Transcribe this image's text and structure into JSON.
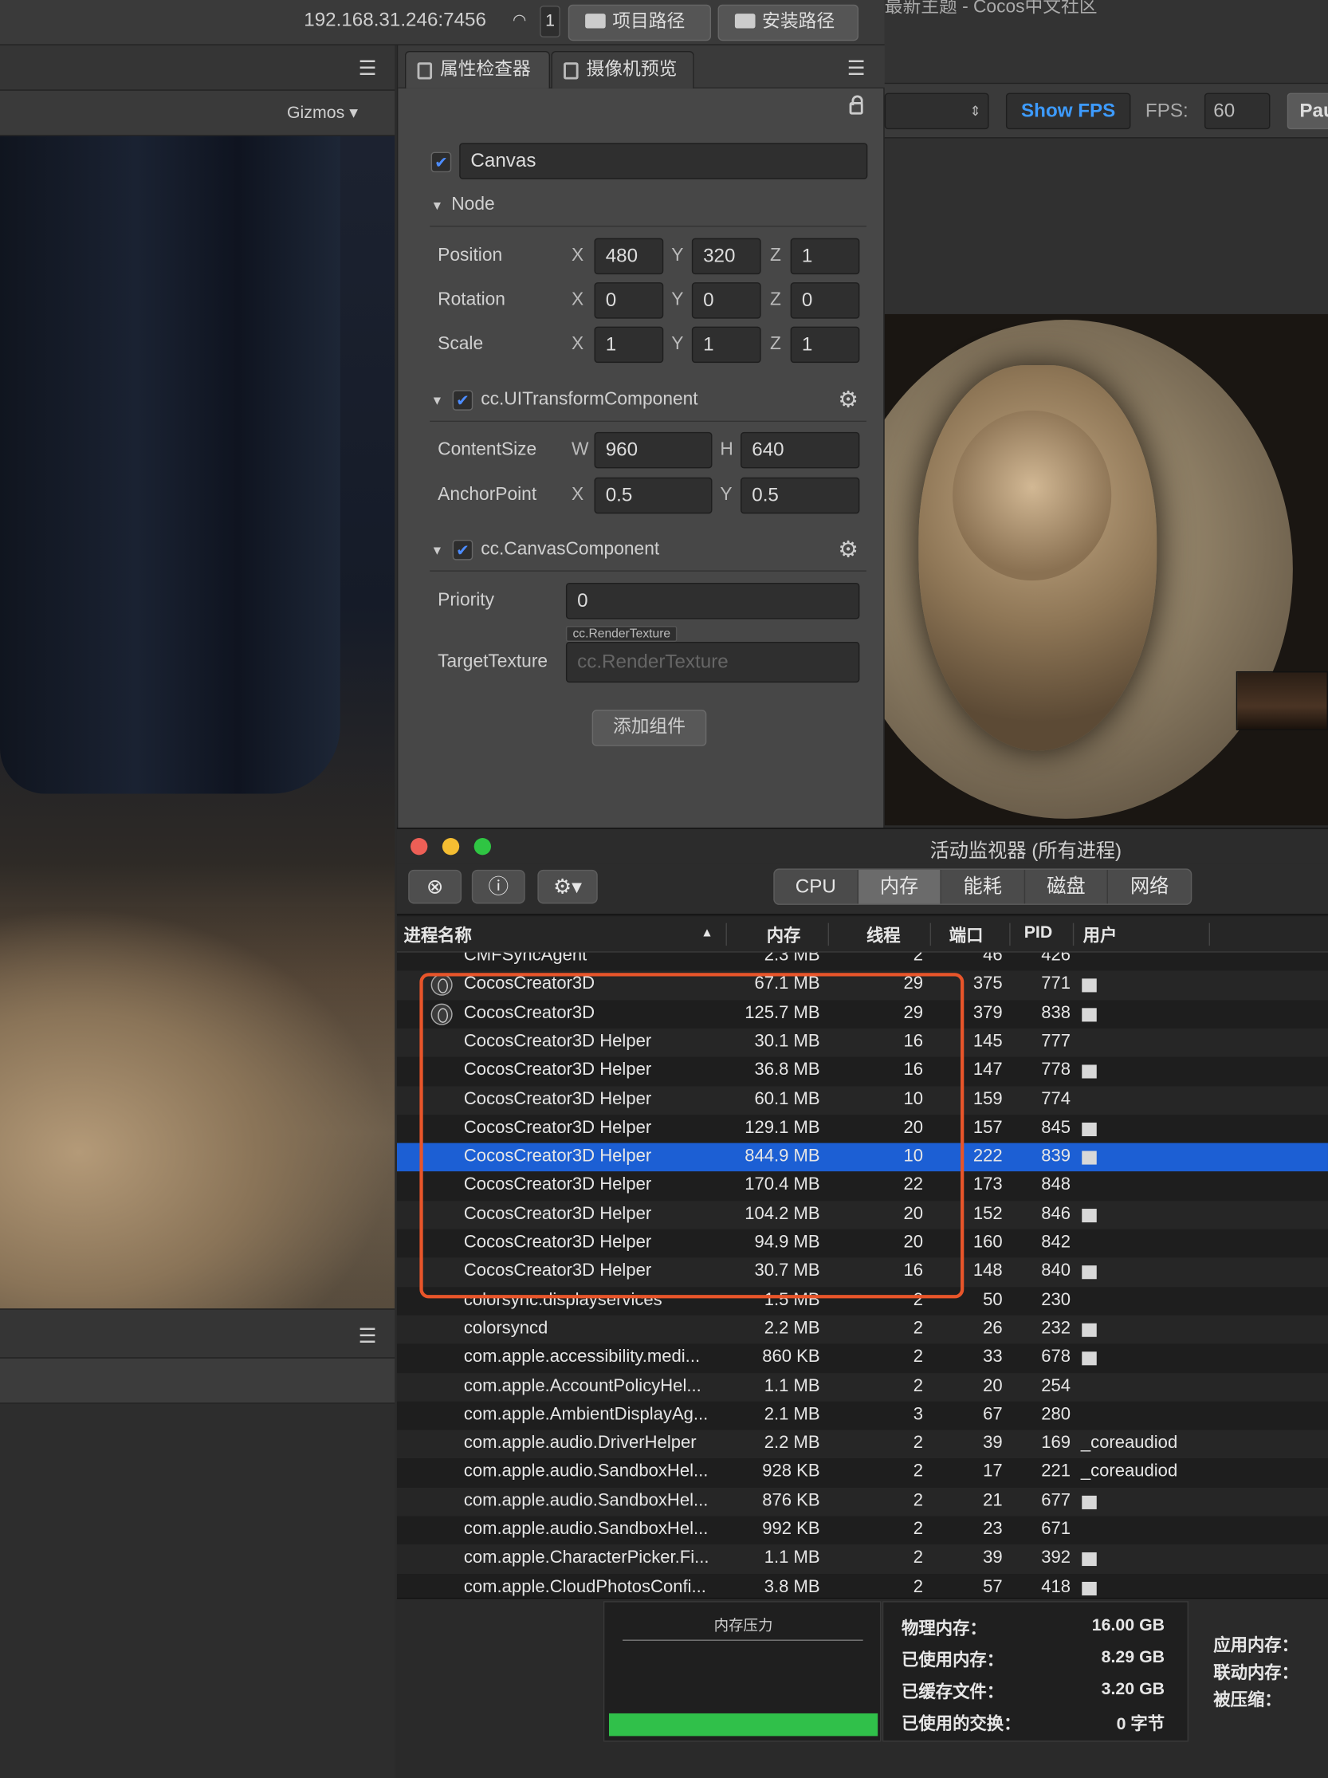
{
  "topbar": {
    "ip": "192.168.31.246:7456",
    "badge": "1",
    "project_path_label": "项目路径",
    "install_path_label": "安装路径"
  },
  "scene": {
    "gizmos_label": "Gizmos"
  },
  "inspector": {
    "tabs": [
      {
        "label": "属性检查器"
      },
      {
        "label": "摄像机预览"
      }
    ],
    "node_name": "Canvas",
    "node_section": "Node",
    "position": {
      "label": "Position",
      "x": "480",
      "y": "320",
      "z": "1"
    },
    "rotation": {
      "label": "Rotation",
      "x": "0",
      "y": "0",
      "z": "0"
    },
    "scale": {
      "label": "Scale",
      "x": "1",
      "y": "1",
      "z": "1"
    },
    "ui_transform": {
      "title": "cc.UITransformComponent",
      "content_size_label": "ContentSize",
      "w": "960",
      "h": "640",
      "anchor_label": "AnchorPoint",
      "ax": "0.5",
      "ay": "0.5"
    },
    "canvas_component": {
      "title": "cc.CanvasComponent",
      "priority_label": "Priority",
      "priority": "0",
      "target_label": "TargetTexture",
      "target_tag": "cc.RenderTexture",
      "target_placeholder": "cc.RenderTexture"
    },
    "add_component": "添加组件",
    "axes": {
      "x": "X",
      "y": "Y",
      "z": "Z",
      "w": "W",
      "h": "H"
    }
  },
  "gameview": {
    "tab_text": "最新主题 - Cocos中文社区",
    "show_fps": "Show FPS",
    "fps_label": "FPS:",
    "fps_value": "60",
    "pause_label": "Pau"
  },
  "activity_monitor": {
    "title": "活动监视器 (所有进程)",
    "tabs": [
      "CPU",
      "内存",
      "能耗",
      "磁盘",
      "网络"
    ],
    "active_tab": "内存",
    "columns": {
      "name": "进程名称",
      "memory": "内存",
      "threads": "线程",
      "ports": "端口",
      "pid": "PID",
      "user": "用户"
    },
    "rows": [
      {
        "name": "CMFSyncAgent",
        "mem": "2.3 MB",
        "thr": "2",
        "port": "46",
        "pid": "426",
        "user": "",
        "icon": false,
        "sel": false,
        "ucell": false
      },
      {
        "name": "CocosCreator3D",
        "mem": "67.1 MB",
        "thr": "29",
        "port": "375",
        "pid": "771",
        "user": "",
        "icon": true,
        "sel": false,
        "ucell": true
      },
      {
        "name": "CocosCreator3D",
        "mem": "125.7 MB",
        "thr": "29",
        "port": "379",
        "pid": "838",
        "user": "",
        "icon": true,
        "sel": false,
        "ucell": true
      },
      {
        "name": "CocosCreator3D Helper",
        "mem": "30.1 MB",
        "thr": "16",
        "port": "145",
        "pid": "777",
        "user": "",
        "icon": false,
        "sel": false,
        "ucell": false
      },
      {
        "name": "CocosCreator3D Helper",
        "mem": "36.8 MB",
        "thr": "16",
        "port": "147",
        "pid": "778",
        "user": "",
        "icon": false,
        "sel": false,
        "ucell": true
      },
      {
        "name": "CocosCreator3D Helper",
        "mem": "60.1 MB",
        "thr": "10",
        "port": "159",
        "pid": "774",
        "user": "",
        "icon": false,
        "sel": false,
        "ucell": false
      },
      {
        "name": "CocosCreator3D Helper",
        "mem": "129.1 MB",
        "thr": "20",
        "port": "157",
        "pid": "845",
        "user": "",
        "icon": false,
        "sel": false,
        "ucell": true
      },
      {
        "name": "CocosCreator3D Helper",
        "mem": "844.9 MB",
        "thr": "10",
        "port": "222",
        "pid": "839",
        "user": "",
        "icon": false,
        "sel": true,
        "ucell": true
      },
      {
        "name": "CocosCreator3D Helper",
        "mem": "170.4 MB",
        "thr": "22",
        "port": "173",
        "pid": "848",
        "user": "",
        "icon": false,
        "sel": false,
        "ucell": false
      },
      {
        "name": "CocosCreator3D Helper",
        "mem": "104.2 MB",
        "thr": "20",
        "port": "152",
        "pid": "846",
        "user": "",
        "icon": false,
        "sel": false,
        "ucell": true
      },
      {
        "name": "CocosCreator3D Helper",
        "mem": "94.9 MB",
        "thr": "20",
        "port": "160",
        "pid": "842",
        "user": "",
        "icon": false,
        "sel": false,
        "ucell": false
      },
      {
        "name": "CocosCreator3D Helper",
        "mem": "30.7 MB",
        "thr": "16",
        "port": "148",
        "pid": "840",
        "user": "",
        "icon": false,
        "sel": false,
        "ucell": true
      },
      {
        "name": "colorsync.displayservices",
        "mem": "1.5 MB",
        "thr": "2",
        "port": "50",
        "pid": "230",
        "user": "",
        "icon": false,
        "sel": false,
        "ucell": false
      },
      {
        "name": "colorsyncd",
        "mem": "2.2 MB",
        "thr": "2",
        "port": "26",
        "pid": "232",
        "user": "",
        "icon": false,
        "sel": false,
        "ucell": true
      },
      {
        "name": "com.apple.accessibility.medi...",
        "mem": "860 KB",
        "thr": "2",
        "port": "33",
        "pid": "678",
        "user": "",
        "icon": false,
        "sel": false,
        "ucell": true
      },
      {
        "name": "com.apple.AccountPolicyHel...",
        "mem": "1.1 MB",
        "thr": "2",
        "port": "20",
        "pid": "254",
        "user": "",
        "icon": false,
        "sel": false,
        "ucell": false
      },
      {
        "name": "com.apple.AmbientDisplayAg...",
        "mem": "2.1 MB",
        "thr": "3",
        "port": "67",
        "pid": "280",
        "user": "",
        "icon": false,
        "sel": false,
        "ucell": false
      },
      {
        "name": "com.apple.audio.DriverHelper",
        "mem": "2.2 MB",
        "thr": "2",
        "port": "39",
        "pid": "169",
        "user": "_coreaudiod",
        "icon": false,
        "sel": false,
        "ucell": false
      },
      {
        "name": "com.apple.audio.SandboxHel...",
        "mem": "928 KB",
        "thr": "2",
        "port": "17",
        "pid": "221",
        "user": "_coreaudiod",
        "icon": false,
        "sel": false,
        "ucell": false
      },
      {
        "name": "com.apple.audio.SandboxHel...",
        "mem": "876 KB",
        "thr": "2",
        "port": "21",
        "pid": "677",
        "user": "",
        "icon": false,
        "sel": false,
        "ucell": true
      },
      {
        "name": "com.apple.audio.SandboxHel...",
        "mem": "992 KB",
        "thr": "2",
        "port": "23",
        "pid": "671",
        "user": "",
        "icon": false,
        "sel": false,
        "ucell": false
      },
      {
        "name": "com.apple.CharacterPicker.Fi...",
        "mem": "1.1 MB",
        "thr": "2",
        "port": "39",
        "pid": "392",
        "user": "",
        "icon": false,
        "sel": false,
        "ucell": true
      },
      {
        "name": "com.apple.CloudPhotosConfi...",
        "mem": "3.8 MB",
        "thr": "2",
        "port": "57",
        "pid": "418",
        "user": "",
        "icon": false,
        "sel": false,
        "ucell": true
      }
    ],
    "pressure_title": "内存压力",
    "stats": [
      {
        "label": "物理内存：",
        "value": "16.00 GB"
      },
      {
        "label": "已使用内存：",
        "value": "8.29 GB"
      },
      {
        "label": "已缓存文件：",
        "value": "3.20 GB"
      },
      {
        "label": "已使用的交换：",
        "value": "0 字节"
      }
    ],
    "app_stats": [
      "应用内存：",
      "联动内存：",
      "被压缩："
    ],
    "colors": {
      "selection": "#1c5fd4",
      "highlight_box": "#e8552a",
      "pressure_graph": "#30c04a"
    }
  }
}
